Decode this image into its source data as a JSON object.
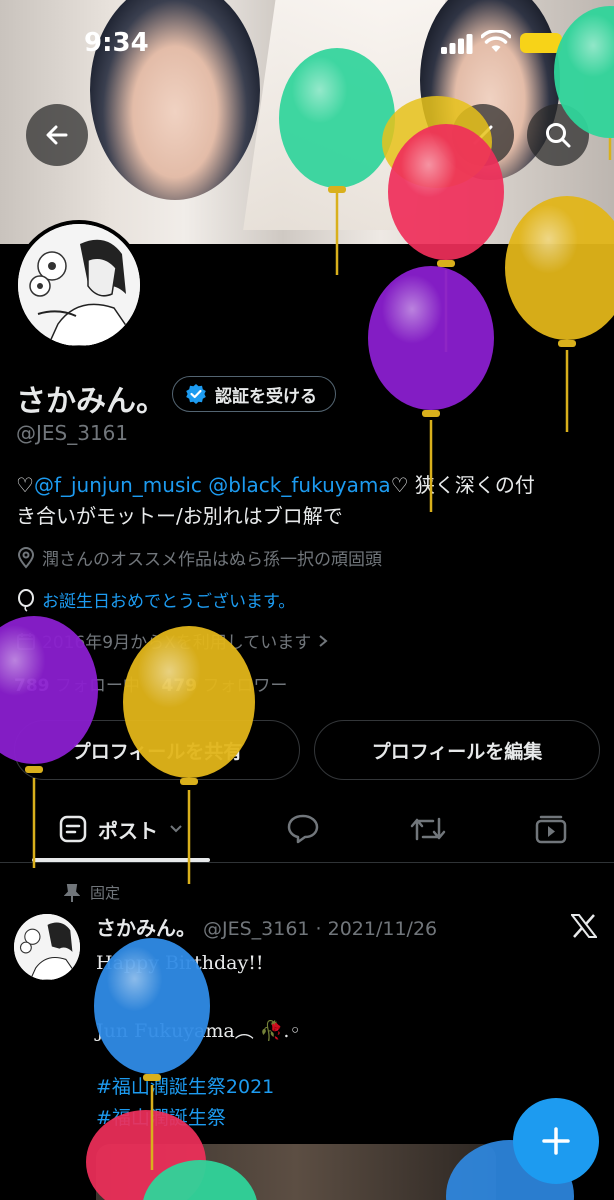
{
  "status_bar": {
    "time": "9:34"
  },
  "profile": {
    "display_name": "さかみん。",
    "verify_label": "認証を受ける",
    "handle": "@JES_3161",
    "bio_prefix": "♡",
    "bio_mention1": "@f_junjun_music",
    "bio_mention2": "@black_fukuyama",
    "bio_line1_rest": "♡ 狭く深くの付",
    "bio_line2": "き合いがモットー/お別れはブロ解で",
    "location": "潤さんのオススメ作品はぬら孫一択の頑固頭",
    "birthday": "お誕生日おめでとうございます。",
    "joined": "2016年9月からXを利用しています",
    "following_count": "789",
    "following_label": "フォロー中",
    "followers_count": "479",
    "followers_label": "フォロワー"
  },
  "buttons": {
    "share_profile": "プロフィールを共有",
    "edit_profile": "プロフィールを編集"
  },
  "tabs": {
    "posts_label": "ポスト"
  },
  "pinned_tweet": {
    "pinned_label": "固定",
    "author": "さかみん。",
    "handle_date": "@JES_3161 · 2021/11/26",
    "line1": "Happy Birthday!!",
    "line2": "Jun Fukuyama︵ 🥀.◦",
    "hashtag1": "#福山潤誕生祭2021",
    "hashtag2": "#福山潤誕生祭"
  },
  "icons": [
    "back-arrow-icon",
    "grok-icon",
    "search-icon",
    "verified-badge-icon",
    "location-icon",
    "balloon-icon",
    "calendar-icon",
    "chevron-right-icon",
    "post-tab-icon",
    "chevron-down-icon",
    "reply-tab-icon",
    "repost-tab-icon",
    "media-tab-icon",
    "pin-icon",
    "x-logo-icon",
    "plus-icon"
  ],
  "colors": {
    "accent": "#1d9bf0",
    "background": "#000000",
    "battery": "#f7d318"
  }
}
